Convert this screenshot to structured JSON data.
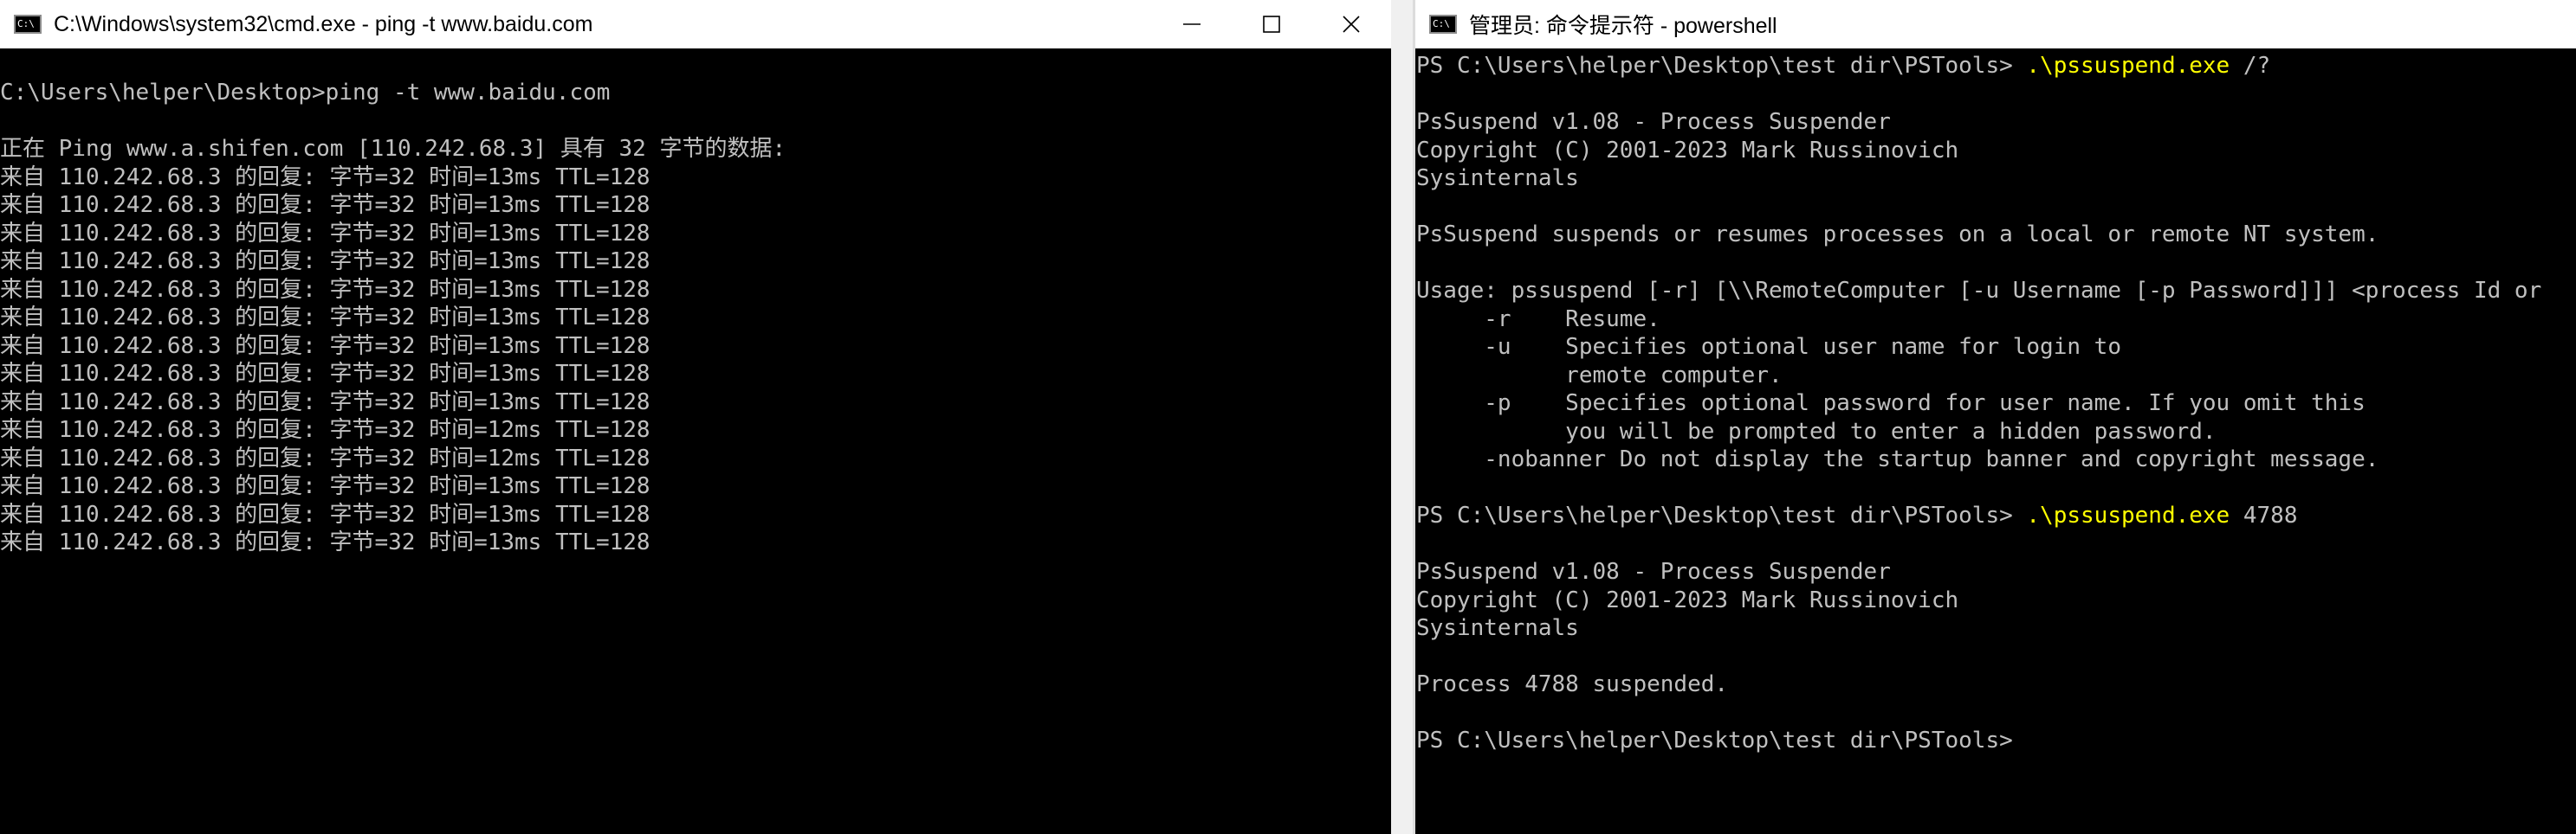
{
  "left_window": {
    "title": "C:\\Windows\\system32\\cmd.exe - ping  -t www.baidu.com",
    "icon": "cmd-icon",
    "icon_text": "C:\\",
    "console_lines": [
      "C:\\Users\\helper\\Desktop>ping -t www.baidu.com",
      "",
      "正在 Ping www.a.shifen.com [110.242.68.3] 具有 32 字节的数据:",
      "来自 110.242.68.3 的回复: 字节=32 时间=13ms TTL=128",
      "来自 110.242.68.3 的回复: 字节=32 时间=13ms TTL=128",
      "来自 110.242.68.3 的回复: 字节=32 时间=13ms TTL=128",
      "来自 110.242.68.3 的回复: 字节=32 时间=13ms TTL=128",
      "来自 110.242.68.3 的回复: 字节=32 时间=13ms TTL=128",
      "来自 110.242.68.3 的回复: 字节=32 时间=13ms TTL=128",
      "来自 110.242.68.3 的回复: 字节=32 时间=13ms TTL=128",
      "来自 110.242.68.3 的回复: 字节=32 时间=13ms TTL=128",
      "来自 110.242.68.3 的回复: 字节=32 时间=13ms TTL=128",
      "来自 110.242.68.3 的回复: 字节=32 时间=12ms TTL=128",
      "来自 110.242.68.3 的回复: 字节=32 时间=12ms TTL=128",
      "来自 110.242.68.3 的回复: 字节=32 时间=13ms TTL=128",
      "来自 110.242.68.3 的回复: 字节=32 时间=13ms TTL=128",
      "来自 110.242.68.3 的回复: 字节=32 时间=13ms TTL=128"
    ]
  },
  "right_window": {
    "title": "管理员: 命令提示符 - powershell",
    "icon": "cmd-icon",
    "icon_text": "C:\\",
    "prompt": "PS C:\\Users\\helper\\Desktop\\test dir\\PSTools> ",
    "cmd1_exe": ".\\pssuspend.exe",
    "cmd1_arg": " /?",
    "banner_1": [
      "PsSuspend v1.08 - Process Suspender",
      "Copyright (C) 2001-2023 Mark Russinovich",
      "Sysinternals"
    ],
    "help_lines": [
      "PsSuspend suspends or resumes processes on a local or remote NT system.",
      "",
      "Usage: pssuspend [-r] [\\\\RemoteComputer [-u Username [-p Password]]] <process Id or",
      "     -r    Resume.",
      "     -u    Specifies optional user name for login to",
      "           remote computer.",
      "     -p    Specifies optional password for user name. If you omit this",
      "           you will be prompted to enter a hidden password.",
      "     -nobanner Do not display the startup banner and copyright message."
    ],
    "cmd2_exe": ".\\pssuspend.exe",
    "cmd2_arg": " 4788",
    "banner_2": [
      "PsSuspend v1.08 - Process Suspender",
      "Copyright (C) 2001-2023 Mark Russinovich",
      "Sysinternals"
    ],
    "result": "Process 4788 suspended."
  },
  "colors": {
    "console_bg": "#000000",
    "console_text": "#c0c0c0",
    "powershell_command": "#ffff00",
    "titlebar_bg": "#ffffff"
  }
}
